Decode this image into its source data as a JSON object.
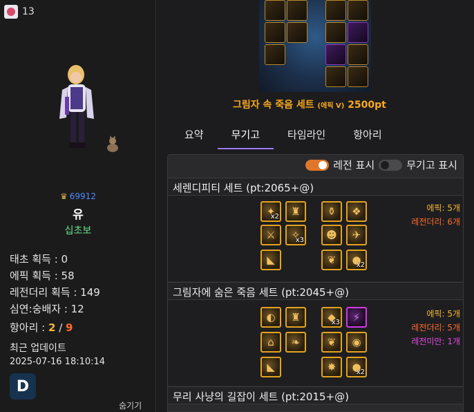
{
  "profile": {
    "rank_icon": "red-emblem-icon",
    "rank_number": "13",
    "fame_icon": "crown-icon",
    "fame": "69912",
    "name": "유",
    "job": "십초보",
    "stats": [
      "태초 획득 : 0",
      "에픽 획득 : 58",
      "레전더리 획득 : 149",
      "심연:숭배자 : 12"
    ],
    "hangari_label": "항아리 : ",
    "hangari_a": "2",
    "hangari_sep": " / ",
    "hangari_b": "9",
    "update_label": "최근 업데이트",
    "update_time": "2025-07-16 18:10:14",
    "badge_letter": "D",
    "hide_label": "숨기기"
  },
  "banner": {
    "title_main": "그림자 속 죽음 세트",
    "title_small": "(에픽 V)",
    "title_pt": "2500pt"
  },
  "tabs": [
    {
      "label": "요약"
    },
    {
      "label": "무기고"
    },
    {
      "label": "타임라인"
    },
    {
      "label": "항아리"
    }
  ],
  "active_tab": "무기고",
  "toggles": {
    "legend_label": "레전 표시",
    "legend_on": true,
    "armory_label": "무기고 표시",
    "armory_on": false
  },
  "sets": [
    {
      "title": "세렌디피티 세트 (pt:2065+@)",
      "counts": [
        {
          "text": "에픽: 5개",
          "kind": "epic"
        },
        {
          "text": "레전더리: 6개",
          "kind": "legend"
        }
      ],
      "left_items": [
        {
          "mult": "x2"
        },
        {
          "mult": ""
        },
        {
          "mult": ""
        },
        {
          "mult": "x3"
        },
        {
          "mult": ""
        }
      ],
      "right_items": [
        {
          "mult": ""
        },
        {
          "mult": ""
        },
        {
          "mult": ""
        },
        {
          "mult": ""
        },
        {
          "mult": ""
        },
        {
          "mult": "x2"
        }
      ]
    },
    {
      "title": "그림자에 숨은 죽음 세트 (pt:2045+@)",
      "counts": [
        {
          "text": "에픽: 5개",
          "kind": "epic"
        },
        {
          "text": "레전더리: 5개",
          "kind": "legend"
        },
        {
          "text": "레전미만: 1개",
          "kind": "sub"
        }
      ],
      "left_items": [
        {
          "mult": ""
        },
        {
          "mult": ""
        },
        {
          "mult": ""
        },
        {
          "mult": ""
        },
        {
          "mult": ""
        }
      ],
      "right_items": [
        {
          "mult": "x3"
        },
        {
          "mult": ""
        },
        {
          "mult": ""
        },
        {
          "mult": ""
        },
        {
          "mult": ""
        },
        {
          "mult": "x2"
        }
      ]
    },
    {
      "title": "무리 사냥의 길잡이 세트 (pt:2015+@)"
    }
  ]
}
